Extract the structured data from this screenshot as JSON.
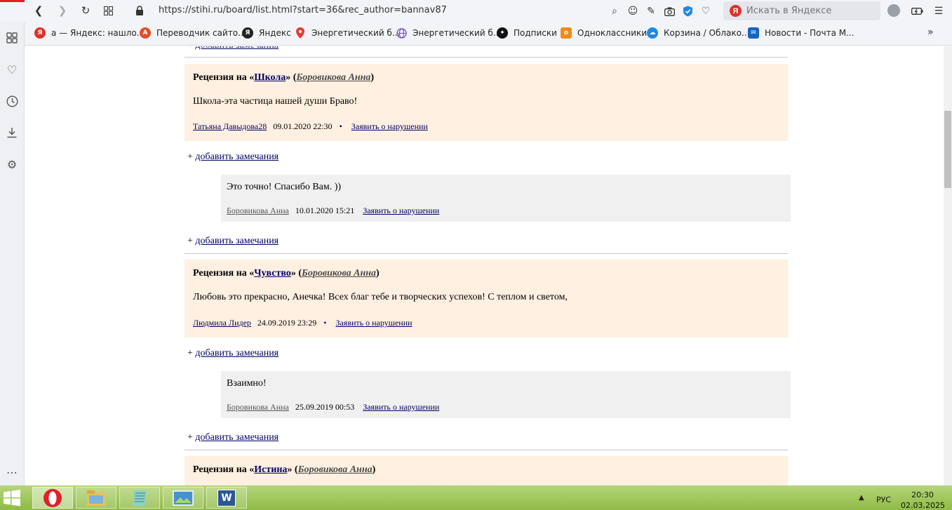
{
  "browser": {
    "url": "https://stihi.ru/board/list.html?start=36&rec_author=bannav87",
    "search_placeholder": "Искать в Яндексе",
    "yandex_logo": "Я",
    "more_label": "»"
  },
  "bookmarks": [
    {
      "label": "а — Яндекс: нашло...",
      "icon": "yandex-icon",
      "color": "#e0302a",
      "glyph": "Я"
    },
    {
      "label": "Переводчик сайто...",
      "icon": "translator-icon",
      "color": "#e14d2a",
      "glyph": "A"
    },
    {
      "label": "Яндекс",
      "icon": "yandex-icon",
      "color": "#222222",
      "glyph": "Я"
    },
    {
      "label": "Энергетический б...",
      "icon": "map-pin-icon",
      "color": "#e53935",
      "glyph": ""
    },
    {
      "label": "Энергетический б...",
      "icon": "globe-icon",
      "color": "#7e57c2",
      "glyph": ""
    },
    {
      "label": "Подписки",
      "icon": "star-icon",
      "color": "#111111",
      "glyph": "✦"
    },
    {
      "label": "Одноклассники",
      "icon": "odnoklassniki-icon",
      "color": "#f08a1c",
      "glyph": "о"
    },
    {
      "label": "Корзина / Облако...",
      "icon": "cloud-icon",
      "color": "#1e88e5",
      "glyph": "☁"
    },
    {
      "label": "Новости - Почта М...",
      "icon": "mail-icon",
      "color": "#1565c0",
      "glyph": "✉"
    }
  ],
  "content": {
    "add_remark_prefix": "+ ",
    "add_remark_label": "добавить замечания",
    "review_prefix": "Рецензия на «",
    "review_mid": "» (",
    "review_suffix": ")",
    "report_label": "Заявить о нарушении",
    "reviews": [
      {
        "work": "Школа",
        "author": "Боровикова Анна",
        "text": "Школа-эта частица нашей души Браво!",
        "user": "Татьяна Давыдова28",
        "date": "09.01.2020 22:30",
        "reply": {
          "text": "Это точно! Спасибо Вам. ))",
          "user": "Боровикова Анна",
          "date": "10.01.2020 15:21"
        }
      },
      {
        "work": "Чувство",
        "author": "Боровикова Анна",
        "text": "Любовь это прекрасно, Анечка! Всех благ тебе и творческих успехов! С теплом и светом,",
        "user": "Людмила Лидер",
        "date": "24.09.2019 23:29",
        "reply": {
          "text": "Взаимно!",
          "user": "Боровикова Анна",
          "date": "25.09.2019 00:53"
        }
      },
      {
        "work": "Истина",
        "author": "Боровикова Анна"
      }
    ]
  },
  "taskbar": {
    "lang": "РУС",
    "time": "20:30",
    "date": "02.03.2025"
  },
  "colors": {
    "review_bg": "#fff0e1",
    "reply_bg": "#f0f0f0",
    "link": "#000066",
    "taskbar": "#8fbb45"
  }
}
